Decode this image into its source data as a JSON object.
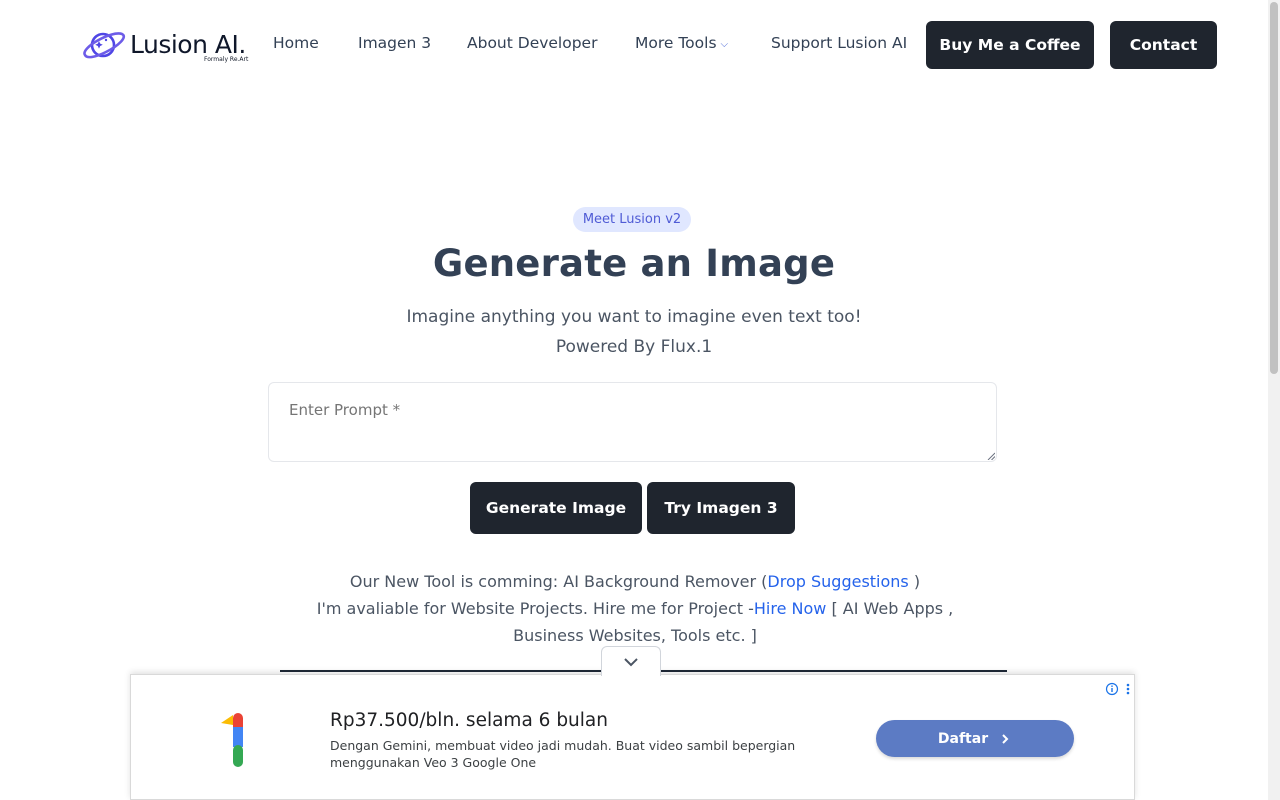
{
  "logo": {
    "name": "Lusion AI.",
    "subtitle": "Formaly Re.Art"
  },
  "nav": {
    "items": [
      "Home",
      "Imagen 3",
      "About Developer",
      "More Tools",
      "Support Lusion AI"
    ],
    "buy_coffee": "Buy Me a Coffee",
    "contact": "Contact"
  },
  "hero": {
    "badge": "Meet Lusion v2",
    "title": "Generate an Image",
    "subtitle": "Imagine anything you want to imagine even text too!",
    "powered": "Powered By Flux.1"
  },
  "prompt": {
    "placeholder": "Enter Prompt *"
  },
  "actions": {
    "generate": "Generate Image",
    "try_imagen": "Try Imagen 3"
  },
  "info": {
    "line1_prefix": "Our New Tool is comming: AI Background Remover (",
    "line1_link": "Drop Suggestions",
    "line1_suffix": " )",
    "line2_prefix": "I'm avaliable for Website Projects. Hire me for Project -",
    "line2_link": "Hire Now",
    "line2_suffix": " [ AI Web Apps , Business Websites, Tools etc. ]"
  },
  "ad": {
    "headline": "Rp37.500/bln. selama 6 bulan",
    "body": "Dengan Gemini, membuat video jadi mudah. Buat video sambil bepergian menggunakan Veo 3 Google One",
    "cta": "Daftar"
  },
  "colors": {
    "accent": "#4f5bd5",
    "dark_button": "#1f252e",
    "link": "#2563eb",
    "ad_cta": "#5c7bc4"
  }
}
